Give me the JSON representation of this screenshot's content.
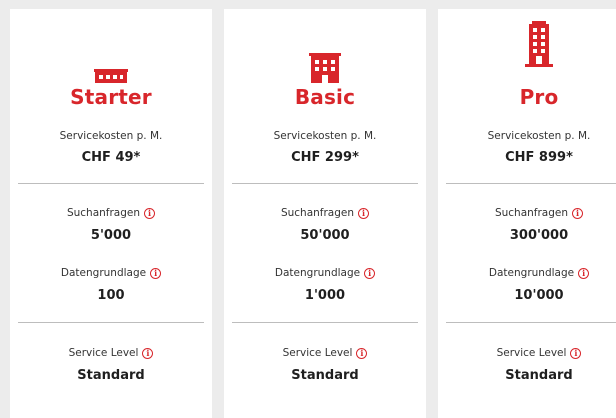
{
  "colors": {
    "accent": "#d8262b",
    "background": "#ececec",
    "card": "#ffffff",
    "divider": "#bdbdbd"
  },
  "info_icon_glyph": "i",
  "plans": [
    {
      "icon": "small-building-icon",
      "name": "Starter",
      "cost_label": "Servicekosten p. M.",
      "cost_value": "CHF 49*",
      "search_label": "Suchanfragen",
      "search_value": "5'000",
      "data_label": "Datengrundlage",
      "data_value": "100",
      "service_label": "Service Level",
      "service_value": "Standard"
    },
    {
      "icon": "medium-building-icon",
      "name": "Basic",
      "cost_label": "Servicekosten p. M.",
      "cost_value": "CHF 299*",
      "search_label": "Suchanfragen",
      "search_value": "50'000",
      "data_label": "Datengrundlage",
      "data_value": "1'000",
      "service_label": "Service Level",
      "service_value": "Standard"
    },
    {
      "icon": "tall-building-icon",
      "name": "Pro",
      "cost_label": "Servicekosten p. M.",
      "cost_value": "CHF 899*",
      "search_label": "Suchanfragen",
      "search_value": "300'000",
      "data_label": "Datengrundlage",
      "data_value": "10'000",
      "service_label": "Service Level",
      "service_value": "Standard"
    }
  ]
}
